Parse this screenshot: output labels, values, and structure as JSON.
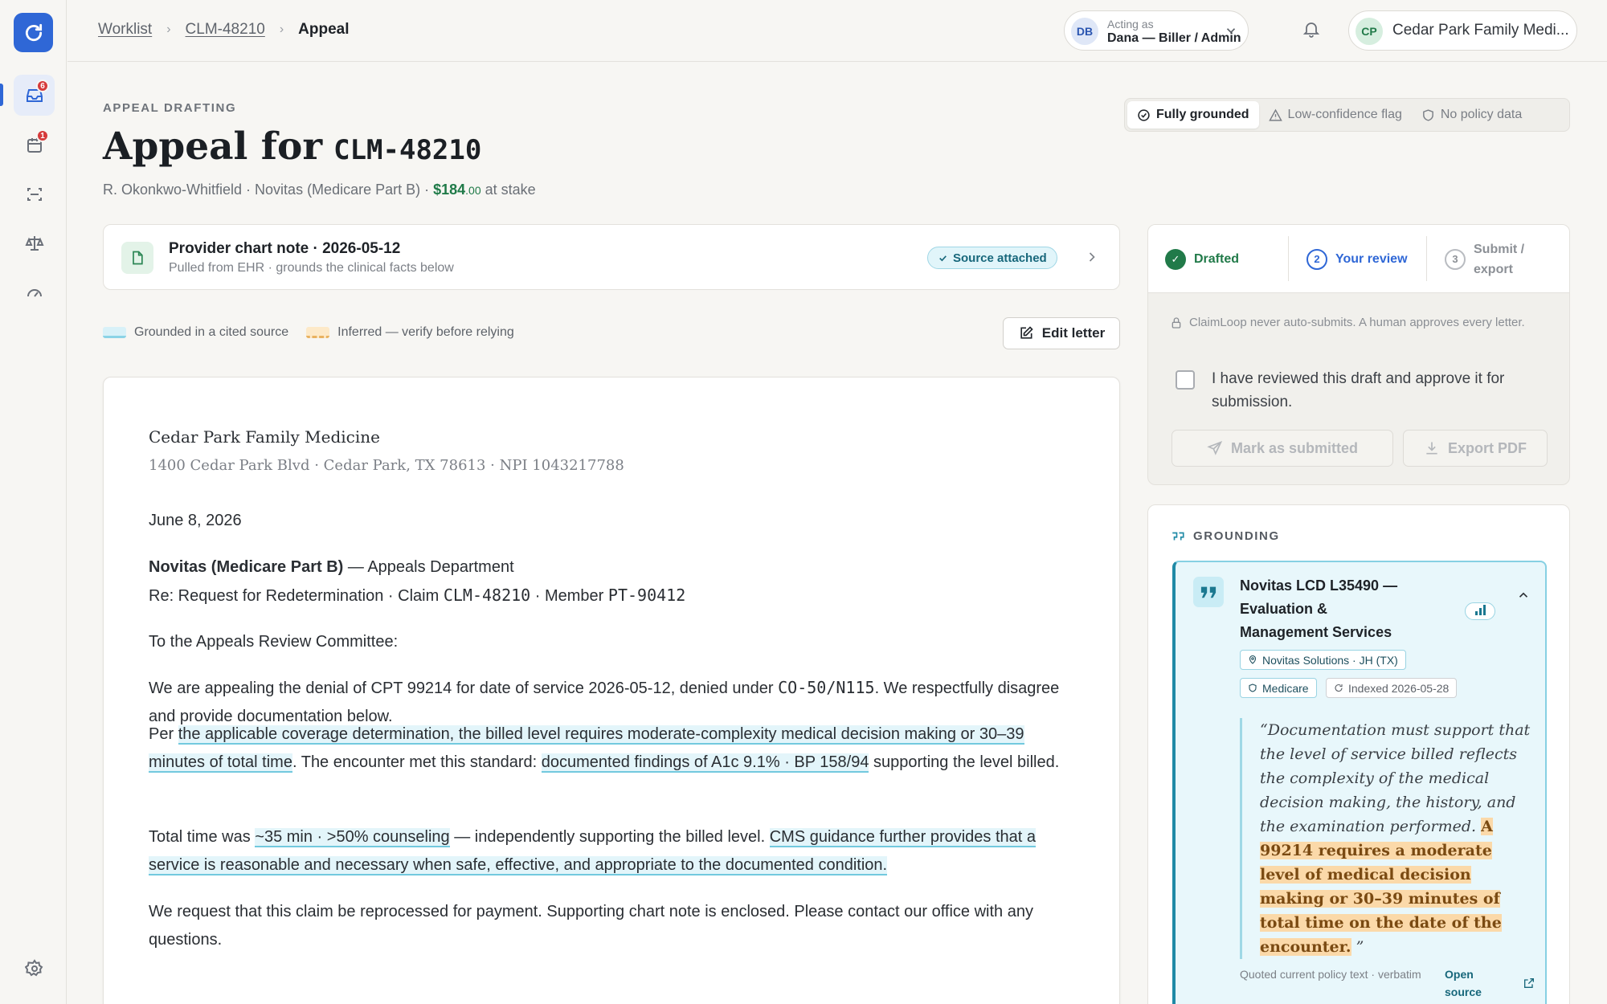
{
  "rail": {
    "inbox_badge": "6",
    "calendar_badge": "1"
  },
  "breadcrumb": {
    "items": [
      "Worklist",
      "CLM-48210"
    ],
    "current": "Appeal"
  },
  "acting_as": {
    "initials": "DB",
    "label": "Acting as",
    "user": "Dana — Biller / Admin"
  },
  "org": {
    "initials": "CP",
    "name": "Cedar Park Family Medi..."
  },
  "page": {
    "eyebrow": "APPEAL DRAFTING",
    "title_prefix": "Appeal for",
    "claim_id": "CLM-48210",
    "patient_payer": "R. Okonkwo-Whitfield · Novitas (Medicare Part B) ·",
    "amount": "$184",
    "amount_cents": ".00",
    "amount_suffix": "at stake"
  },
  "grounding_modes": {
    "items": [
      "Fully grounded",
      "Low-confidence flag",
      "No policy data"
    ],
    "selected": "Fully grounded"
  },
  "source_note": {
    "title": "Provider chart note · 2026-05-12",
    "subtitle": "Pulled from EHR · grounds the clinical facts below",
    "badge": "Source attached"
  },
  "legend": {
    "grounded": "Grounded in a cited source",
    "inferred": "Inferred — verify before relying"
  },
  "edit_label": "Edit letter",
  "letter": {
    "sender_name": "Cedar Park Family Medicine",
    "sender_address": "1400 Cedar Park Blvd · Cedar Park, TX 78613 · NPI 1043217788",
    "date": "June 8, 2026",
    "recipient": "Novitas (Medicare Part B)",
    "recipient_dept": "— Appeals Department",
    "re_prefix": "Re: Request for Redetermination · Claim",
    "re_claim": "CLM-48210",
    "re_member_prefix": "· Member",
    "re_member": "PT-90412",
    "salutation": "To the Appeals Review Committee:",
    "p1_a": "We are appealing the denial of CPT 99214 for date of service 2026-05-12, denied under",
    "p1_code": "CO-50/N115",
    "p1_b": ". We respectfully disagree and provide documentation below.",
    "p2_a": "Per",
    "p2_hl1": "the applicable coverage determination, the billed level requires moderate-complexity medical decision making or 30–39 minutes of total time",
    "p2_b": ". The encounter met this standard:",
    "p2_hl2": "documented findings of A1c 9.1% · BP 158/94",
    "p2_c": "supporting the level billed.",
    "p3_a": "Total time was",
    "p3_hl1": "~35 min · >50% counseling",
    "p3_b": "— independently supporting the billed level.",
    "p3_hl2": "CMS guidance further provides that a service is reasonable and necessary when safe, effective, and appropriate to the documented condition.",
    "p4": "We request that this claim be reprocessed for payment. Supporting chart note is enclosed. Please contact our office with any questions."
  },
  "workflow": {
    "steps": [
      {
        "num": "✓",
        "label": "Drafted",
        "state": "done"
      },
      {
        "num": "2",
        "label": "Your review",
        "state": "current"
      },
      {
        "num": "3",
        "label": "Submit / export",
        "state": "todo"
      }
    ],
    "lock_note": "ClaimLoop never auto-submits. A human approves every letter.",
    "approve_label": "I have reviewed this draft and approve it for submission.",
    "submit_label": "Mark as submitted",
    "export_label": "Export PDF"
  },
  "grounding": {
    "heading": "GROUNDING",
    "source_title": "Novitas LCD L35490 — Evaluation & Management Services",
    "chip_contractor": "Novitas Solutions · JH (TX)",
    "chip_program": "Medicare",
    "chip_indexed": "Indexed 2026-05-28",
    "quote_open": "“Documentation must support that the level of service billed reflects the complexity of the medical decision making, the history, and the examination performed.",
    "quote_highlight": "A 99214 requires a moderate level of medical decision making or 30–39 minutes of total time on the date of the encounter.",
    "quote_close": "”",
    "footer": "Quoted current policy text · verbatim",
    "open_source": "Open source"
  },
  "colors": {
    "brand": "#2f67d6",
    "money": "#1f7a48",
    "grounded": "#72c9de",
    "inferred": "#e9b260",
    "badge": "#d63b3b"
  }
}
